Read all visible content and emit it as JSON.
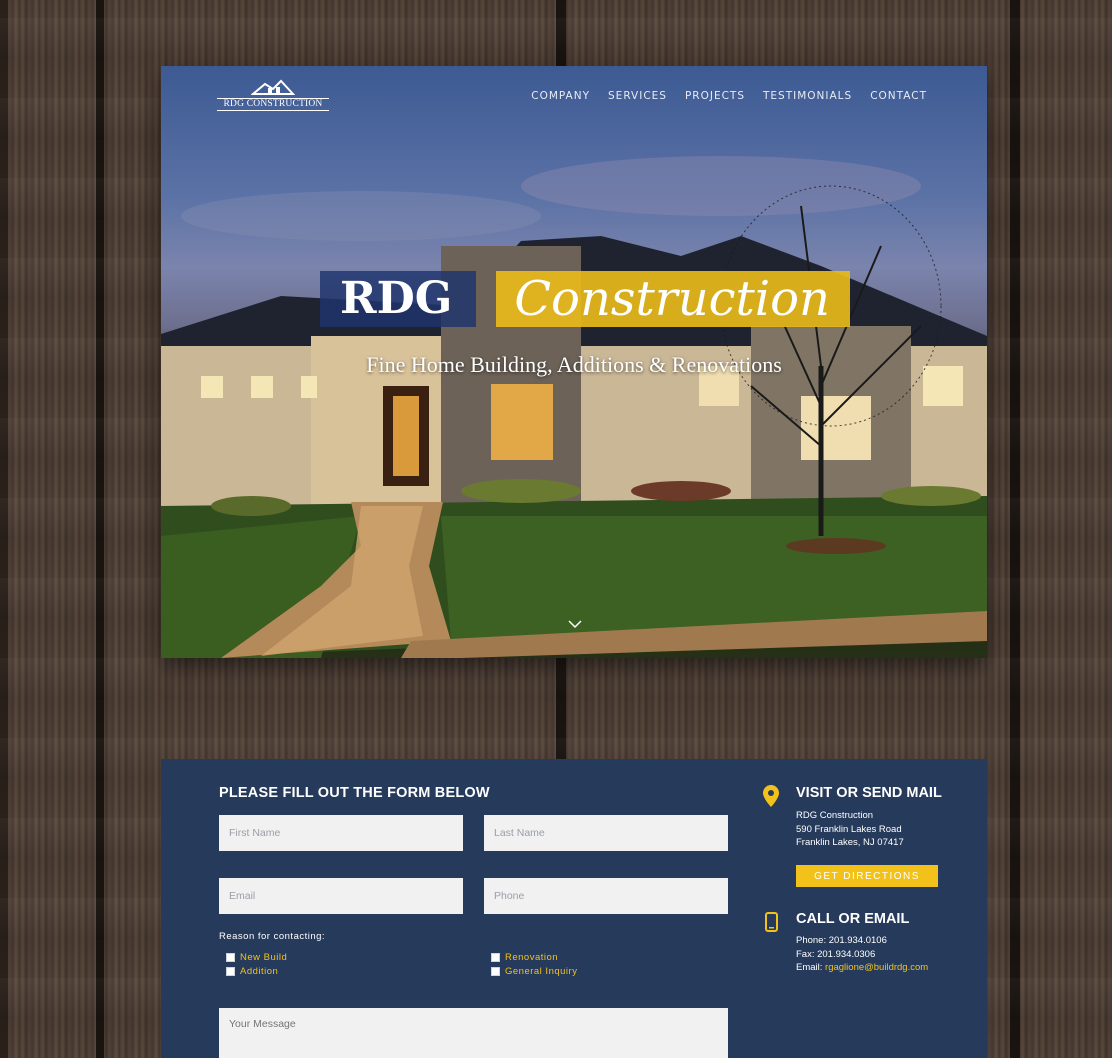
{
  "brand": {
    "logo_text": "RDG CONSTRUCTION"
  },
  "nav": {
    "items": [
      "COMPANY",
      "SERVICES",
      "PROJECTS",
      "TESTIMONIALS",
      "CONTACT"
    ]
  },
  "hero": {
    "title_part1": "RDG",
    "title_part2": "Construction",
    "subtitle": "Fine Home Building, Additions & Renovations"
  },
  "form": {
    "heading": "PLEASE FILL OUT THE FORM BELOW",
    "first_name_placeholder": "First Name",
    "last_name_placeholder": "Last Name",
    "email_placeholder": "Email",
    "phone_placeholder": "Phone",
    "reason_label": "Reason for contacting:",
    "reasons": [
      "New Build",
      "Addition",
      "Renovation",
      "General Inquiry"
    ],
    "message_placeholder": "Your Message"
  },
  "visit": {
    "heading": "VISIT OR SEND MAIL",
    "name": "RDG Construction",
    "street": "590 Franklin Lakes Road",
    "city": "Franklin Lakes, NJ 07417",
    "button": "GET DIRECTIONS"
  },
  "call": {
    "heading": "CALL OR EMAIL",
    "phone": "Phone: 201.934.0106",
    "fax": "Fax: 201.934.0306",
    "email_label": "Email: ",
    "email": "rgaglione@buildrdg.com"
  },
  "colors": {
    "navy": "#263a5c",
    "gold": "#f2c21b",
    "title_blue": "#1e346e"
  }
}
